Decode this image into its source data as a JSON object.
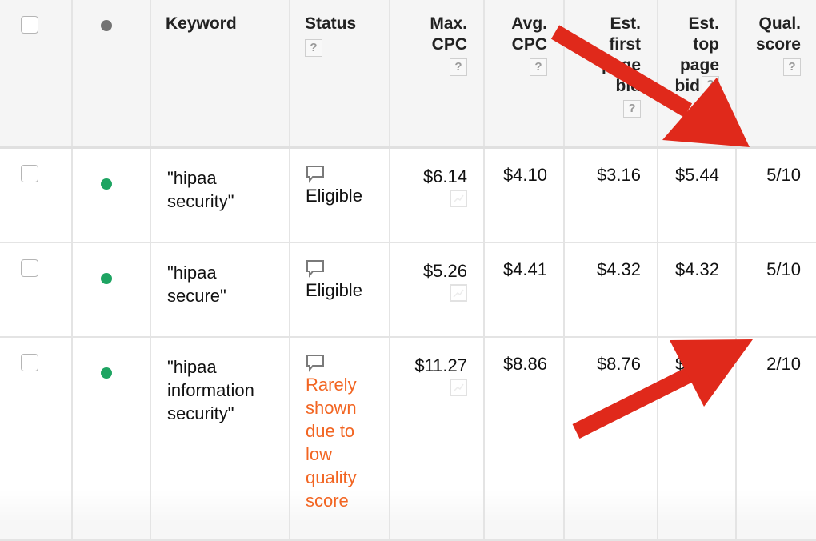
{
  "columns": {
    "keyword": "Keyword",
    "status": "Status",
    "max_cpc": [
      "Max.",
      "CPC"
    ],
    "avg_cpc": [
      "Avg.",
      "CPC"
    ],
    "est_first_page_bid": [
      "Est.",
      "first",
      "page",
      "bid"
    ],
    "est_top_page_bid": [
      "Est.",
      "top",
      "page",
      "bid"
    ],
    "qual_score": [
      "Qual.",
      "score"
    ],
    "help_label": "?"
  },
  "rows": [
    {
      "keyword": [
        "\"hipaa",
        "security\""
      ],
      "status": "Eligible",
      "status_type": "eligible",
      "max_cpc": "$6.14",
      "avg_cpc": "$4.10",
      "est_first_page_bid": "$3.16",
      "est_top_page_bid": "$5.44",
      "qual_score": "5/10"
    },
    {
      "keyword": [
        "\"hipaa",
        "secure\""
      ],
      "status": "Eligible",
      "status_type": "eligible",
      "max_cpc": "$5.26",
      "avg_cpc": "$4.41",
      "est_first_page_bid": "$4.32",
      "est_top_page_bid": "$4.32",
      "qual_score": "5/10"
    },
    {
      "keyword": [
        "\"hipaa",
        "information",
        "security\""
      ],
      "status": [
        "Rarely",
        "shown",
        "due to",
        "low",
        "quality",
        "score"
      ],
      "status_type": "warning",
      "max_cpc": "$11.27",
      "avg_cpc": "$8.86",
      "est_first_page_bid": "$8.76",
      "est_top_page_bid": "$9.07",
      "qual_score": "2/10"
    }
  ],
  "colors": {
    "enabled_dot": "#1ea462",
    "header_dot": "#737373",
    "warning_text": "#f26522",
    "annotation_arrow": "#e0291b"
  },
  "annotations": [
    {
      "type": "arrow",
      "points_to": "qual_score header / row 1 quality score 5/10"
    },
    {
      "type": "arrow",
      "points_to": "row 3 quality score 2/10"
    }
  ]
}
